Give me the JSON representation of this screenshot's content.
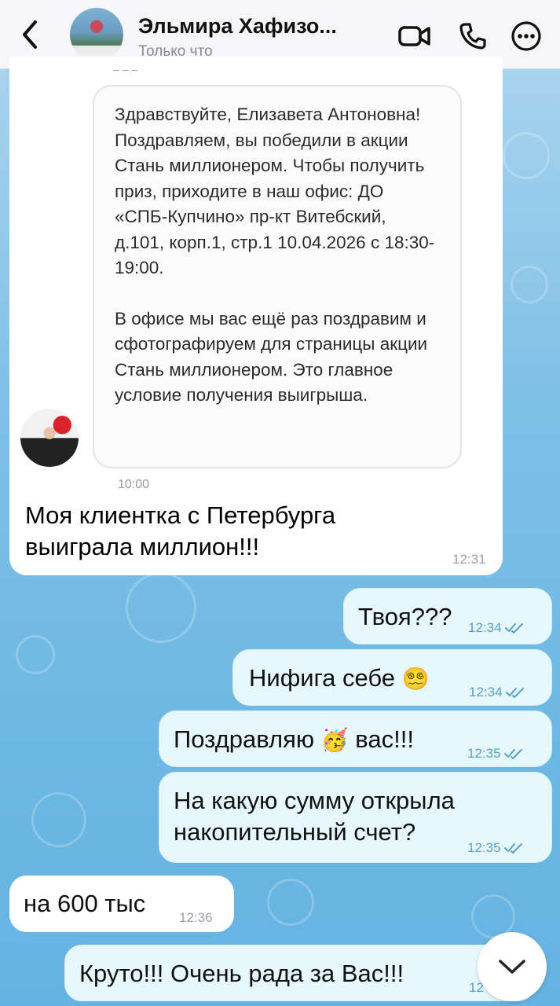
{
  "header": {
    "title": "Эльмира Хафизо...",
    "status": "Только что"
  },
  "screenshot_card": {
    "paragraph1": "Здравствуйте, Елизавета Антоновна! Поздравляем, вы победили в акции Стань миллионером. Чтобы получить приз, приходите в наш офис: ДО «СПБ-Купчино» пр-кт Витебский, д.101, корп.1, стр.1 10.04.2026 с 18:30-19:00.",
    "paragraph2": "В офисе мы вас ещё раз поздравим и сфотографируем для страницы акции Стань миллионером. Это главное условие получения выигрыша.",
    "bottom_cut_text": "10:00"
  },
  "messages": [
    {
      "id": "m1",
      "dir": "in",
      "text_line1": "Моя клиентка с Петербурга",
      "text_line2": "выиграла миллион!!!",
      "time": "12:31"
    },
    {
      "id": "m2",
      "dir": "out",
      "text": "Твоя???",
      "time": "12:34"
    },
    {
      "id": "m3",
      "dir": "out",
      "text": "Нифига себе",
      "emoji": "😵‍💫",
      "time": "12:34"
    },
    {
      "id": "m4",
      "dir": "out",
      "text_before": "Поздравляю",
      "emoji": "🥳",
      "text_after": "вас!!!",
      "time": "12:35"
    },
    {
      "id": "m5",
      "dir": "out",
      "text_line1": "На какую сумму открыла",
      "text_line2": "накопительный счет?",
      "time": "12:35"
    },
    {
      "id": "m6",
      "dir": "in",
      "text": "на 600 тыс",
      "time": "12:36"
    },
    {
      "id": "m7",
      "dir": "out",
      "text": "Круто!!! Очень рада за Вас!!!",
      "time": "12"
    }
  ],
  "colors": {
    "header_bg": "#f6f6f8",
    "incoming_bg": "#ffffff",
    "outgoing_bg": "#e6f7fe",
    "read_checks": "#59a0c8",
    "wallpaper": "#7fc0e6"
  },
  "icons": [
    "back-chevron-icon",
    "video-call-icon",
    "phone-icon",
    "more-options-icon",
    "double-check-icon",
    "chevron-down-icon"
  ]
}
